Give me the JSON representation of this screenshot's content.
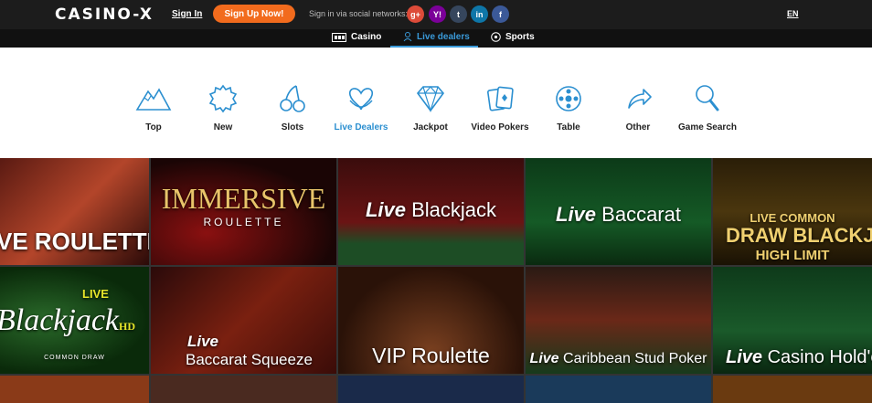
{
  "header": {
    "logo": "CASINO-X",
    "sign_in": "Sign In",
    "sign_up": "Sign Up Now!",
    "social_label": "Sign in via social networks:",
    "social": [
      {
        "icon": "google-plus-icon",
        "glyph": "g+",
        "color": "#dd4b39"
      },
      {
        "icon": "yahoo-icon",
        "glyph": "Y!",
        "color": "#7b0099"
      },
      {
        "icon": "tumblr-icon",
        "glyph": "t",
        "color": "#36465d"
      },
      {
        "icon": "linkedin-icon",
        "glyph": "in",
        "color": "#0e76a8"
      },
      {
        "icon": "facebook-icon",
        "glyph": "f",
        "color": "#3b5998"
      }
    ],
    "language": "EN"
  },
  "subnav": {
    "casino": "Casino",
    "live_dealers": "Live dealers",
    "sports": "Sports"
  },
  "categories": [
    {
      "label": "Top",
      "icon": "mountain-icon"
    },
    {
      "label": "New",
      "icon": "badge-icon"
    },
    {
      "label": "Slots",
      "icon": "cherries-icon"
    },
    {
      "label": "Live Dealers",
      "icon": "dealer-icon",
      "active": true
    },
    {
      "label": "Jackpot",
      "icon": "diamond-icon"
    },
    {
      "label": "Video Pokers",
      "icon": "cards-icon"
    },
    {
      "label": "Table",
      "icon": "chip-icon"
    },
    {
      "label": "Other",
      "icon": "share-arrow-icon"
    },
    {
      "label": "Game Search",
      "icon": "magnifier-icon"
    }
  ],
  "games": {
    "row1": [
      "VE ROULETTE",
      "IMMERSIVE",
      "ROULETTE",
      "Live",
      "Blackjack",
      "Live",
      "Baccarat",
      "LIVE COMMON",
      "DRAW BLACKJAC",
      "HIGH LIMIT"
    ],
    "row2": [
      "LIVE",
      "Blackjack",
      "HD",
      "COMMON DRAW",
      "Live",
      "Baccarat Squeeze",
      "VIP Roulette",
      "Live",
      "Caribbean Stud Poker",
      "Live",
      "Casino Hold'e"
    ]
  },
  "colors": {
    "accent": "#2b8fd0",
    "signup": "#f26b1d",
    "topbar": "#1c1c1c"
  }
}
